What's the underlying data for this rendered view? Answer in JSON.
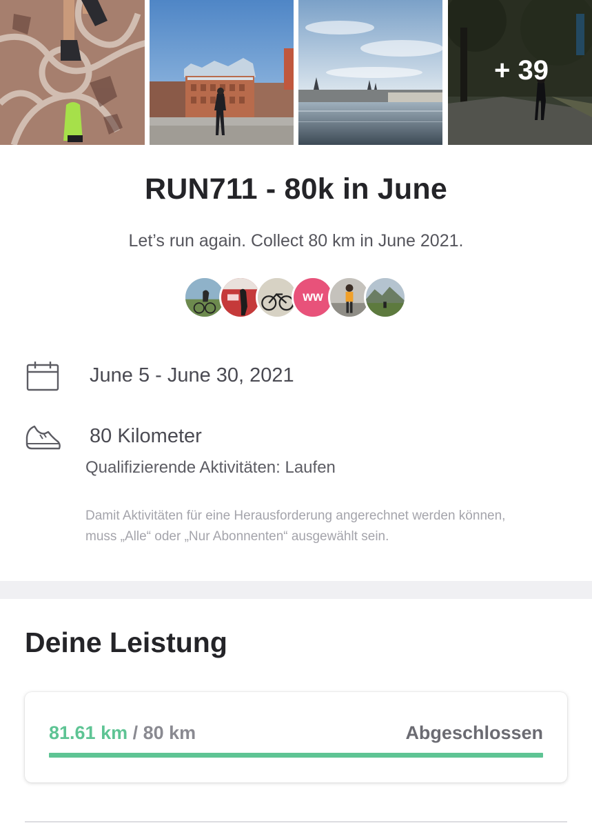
{
  "photos": {
    "more_label": "+ 39"
  },
  "challenge": {
    "title": "RUN711 - 80k in June",
    "subtitle": "Let’s run again. Collect 80 km in June 2021."
  },
  "participants": [
    {
      "name": "participant-cyclist"
    },
    {
      "name": "participant-vita"
    },
    {
      "name": "participant-bike"
    },
    {
      "name": "participant-ww",
      "initials": "ww",
      "color": "#e8527a"
    },
    {
      "name": "participant-runner"
    },
    {
      "name": "participant-mountain"
    }
  ],
  "details": {
    "date_range": "June 5 - June 30, 2021",
    "goal": "80 Kilometer",
    "qualifying": "Qualifizierende Aktivitäten: Laufen",
    "note": "Damit Aktivitäten für eine Herausforderung angerechnet werden können, muss „Alle“ oder „Nur Abonnenten“ ausgewählt sein.",
    "calendar_icon": "calendar-icon",
    "shoe_icon": "shoe-icon"
  },
  "performance": {
    "section_title": "Deine Leistung",
    "current": "81.61 km",
    "separator": " / ",
    "goal": "80 km",
    "status": "Abgeschlossen",
    "progress_fraction": 1.0,
    "accent_color": "#5ec494"
  }
}
